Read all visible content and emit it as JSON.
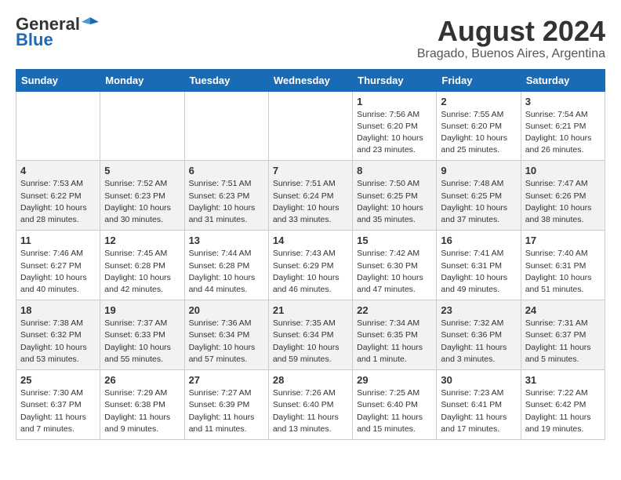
{
  "header": {
    "logo_general": "General",
    "logo_blue": "Blue",
    "month_year": "August 2024",
    "location": "Bragado, Buenos Aires, Argentina"
  },
  "days_of_week": [
    "Sunday",
    "Monday",
    "Tuesday",
    "Wednesday",
    "Thursday",
    "Friday",
    "Saturday"
  ],
  "weeks": [
    [
      {
        "day": "",
        "info": ""
      },
      {
        "day": "",
        "info": ""
      },
      {
        "day": "",
        "info": ""
      },
      {
        "day": "",
        "info": ""
      },
      {
        "day": "1",
        "info": "Sunrise: 7:56 AM\nSunset: 6:20 PM\nDaylight: 10 hours\nand 23 minutes."
      },
      {
        "day": "2",
        "info": "Sunrise: 7:55 AM\nSunset: 6:20 PM\nDaylight: 10 hours\nand 25 minutes."
      },
      {
        "day": "3",
        "info": "Sunrise: 7:54 AM\nSunset: 6:21 PM\nDaylight: 10 hours\nand 26 minutes."
      }
    ],
    [
      {
        "day": "4",
        "info": "Sunrise: 7:53 AM\nSunset: 6:22 PM\nDaylight: 10 hours\nand 28 minutes."
      },
      {
        "day": "5",
        "info": "Sunrise: 7:52 AM\nSunset: 6:23 PM\nDaylight: 10 hours\nand 30 minutes."
      },
      {
        "day": "6",
        "info": "Sunrise: 7:51 AM\nSunset: 6:23 PM\nDaylight: 10 hours\nand 31 minutes."
      },
      {
        "day": "7",
        "info": "Sunrise: 7:51 AM\nSunset: 6:24 PM\nDaylight: 10 hours\nand 33 minutes."
      },
      {
        "day": "8",
        "info": "Sunrise: 7:50 AM\nSunset: 6:25 PM\nDaylight: 10 hours\nand 35 minutes."
      },
      {
        "day": "9",
        "info": "Sunrise: 7:48 AM\nSunset: 6:25 PM\nDaylight: 10 hours\nand 37 minutes."
      },
      {
        "day": "10",
        "info": "Sunrise: 7:47 AM\nSunset: 6:26 PM\nDaylight: 10 hours\nand 38 minutes."
      }
    ],
    [
      {
        "day": "11",
        "info": "Sunrise: 7:46 AM\nSunset: 6:27 PM\nDaylight: 10 hours\nand 40 minutes."
      },
      {
        "day": "12",
        "info": "Sunrise: 7:45 AM\nSunset: 6:28 PM\nDaylight: 10 hours\nand 42 minutes."
      },
      {
        "day": "13",
        "info": "Sunrise: 7:44 AM\nSunset: 6:28 PM\nDaylight: 10 hours\nand 44 minutes."
      },
      {
        "day": "14",
        "info": "Sunrise: 7:43 AM\nSunset: 6:29 PM\nDaylight: 10 hours\nand 46 minutes."
      },
      {
        "day": "15",
        "info": "Sunrise: 7:42 AM\nSunset: 6:30 PM\nDaylight: 10 hours\nand 47 minutes."
      },
      {
        "day": "16",
        "info": "Sunrise: 7:41 AM\nSunset: 6:31 PM\nDaylight: 10 hours\nand 49 minutes."
      },
      {
        "day": "17",
        "info": "Sunrise: 7:40 AM\nSunset: 6:31 PM\nDaylight: 10 hours\nand 51 minutes."
      }
    ],
    [
      {
        "day": "18",
        "info": "Sunrise: 7:38 AM\nSunset: 6:32 PM\nDaylight: 10 hours\nand 53 minutes."
      },
      {
        "day": "19",
        "info": "Sunrise: 7:37 AM\nSunset: 6:33 PM\nDaylight: 10 hours\nand 55 minutes."
      },
      {
        "day": "20",
        "info": "Sunrise: 7:36 AM\nSunset: 6:34 PM\nDaylight: 10 hours\nand 57 minutes."
      },
      {
        "day": "21",
        "info": "Sunrise: 7:35 AM\nSunset: 6:34 PM\nDaylight: 10 hours\nand 59 minutes."
      },
      {
        "day": "22",
        "info": "Sunrise: 7:34 AM\nSunset: 6:35 PM\nDaylight: 11 hours\nand 1 minute."
      },
      {
        "day": "23",
        "info": "Sunrise: 7:32 AM\nSunset: 6:36 PM\nDaylight: 11 hours\nand 3 minutes."
      },
      {
        "day": "24",
        "info": "Sunrise: 7:31 AM\nSunset: 6:37 PM\nDaylight: 11 hours\nand 5 minutes."
      }
    ],
    [
      {
        "day": "25",
        "info": "Sunrise: 7:30 AM\nSunset: 6:37 PM\nDaylight: 11 hours\nand 7 minutes."
      },
      {
        "day": "26",
        "info": "Sunrise: 7:29 AM\nSunset: 6:38 PM\nDaylight: 11 hours\nand 9 minutes."
      },
      {
        "day": "27",
        "info": "Sunrise: 7:27 AM\nSunset: 6:39 PM\nDaylight: 11 hours\nand 11 minutes."
      },
      {
        "day": "28",
        "info": "Sunrise: 7:26 AM\nSunset: 6:40 PM\nDaylight: 11 hours\nand 13 minutes."
      },
      {
        "day": "29",
        "info": "Sunrise: 7:25 AM\nSunset: 6:40 PM\nDaylight: 11 hours\nand 15 minutes."
      },
      {
        "day": "30",
        "info": "Sunrise: 7:23 AM\nSunset: 6:41 PM\nDaylight: 11 hours\nand 17 minutes."
      },
      {
        "day": "31",
        "info": "Sunrise: 7:22 AM\nSunset: 6:42 PM\nDaylight: 11 hours\nand 19 minutes."
      }
    ]
  ]
}
